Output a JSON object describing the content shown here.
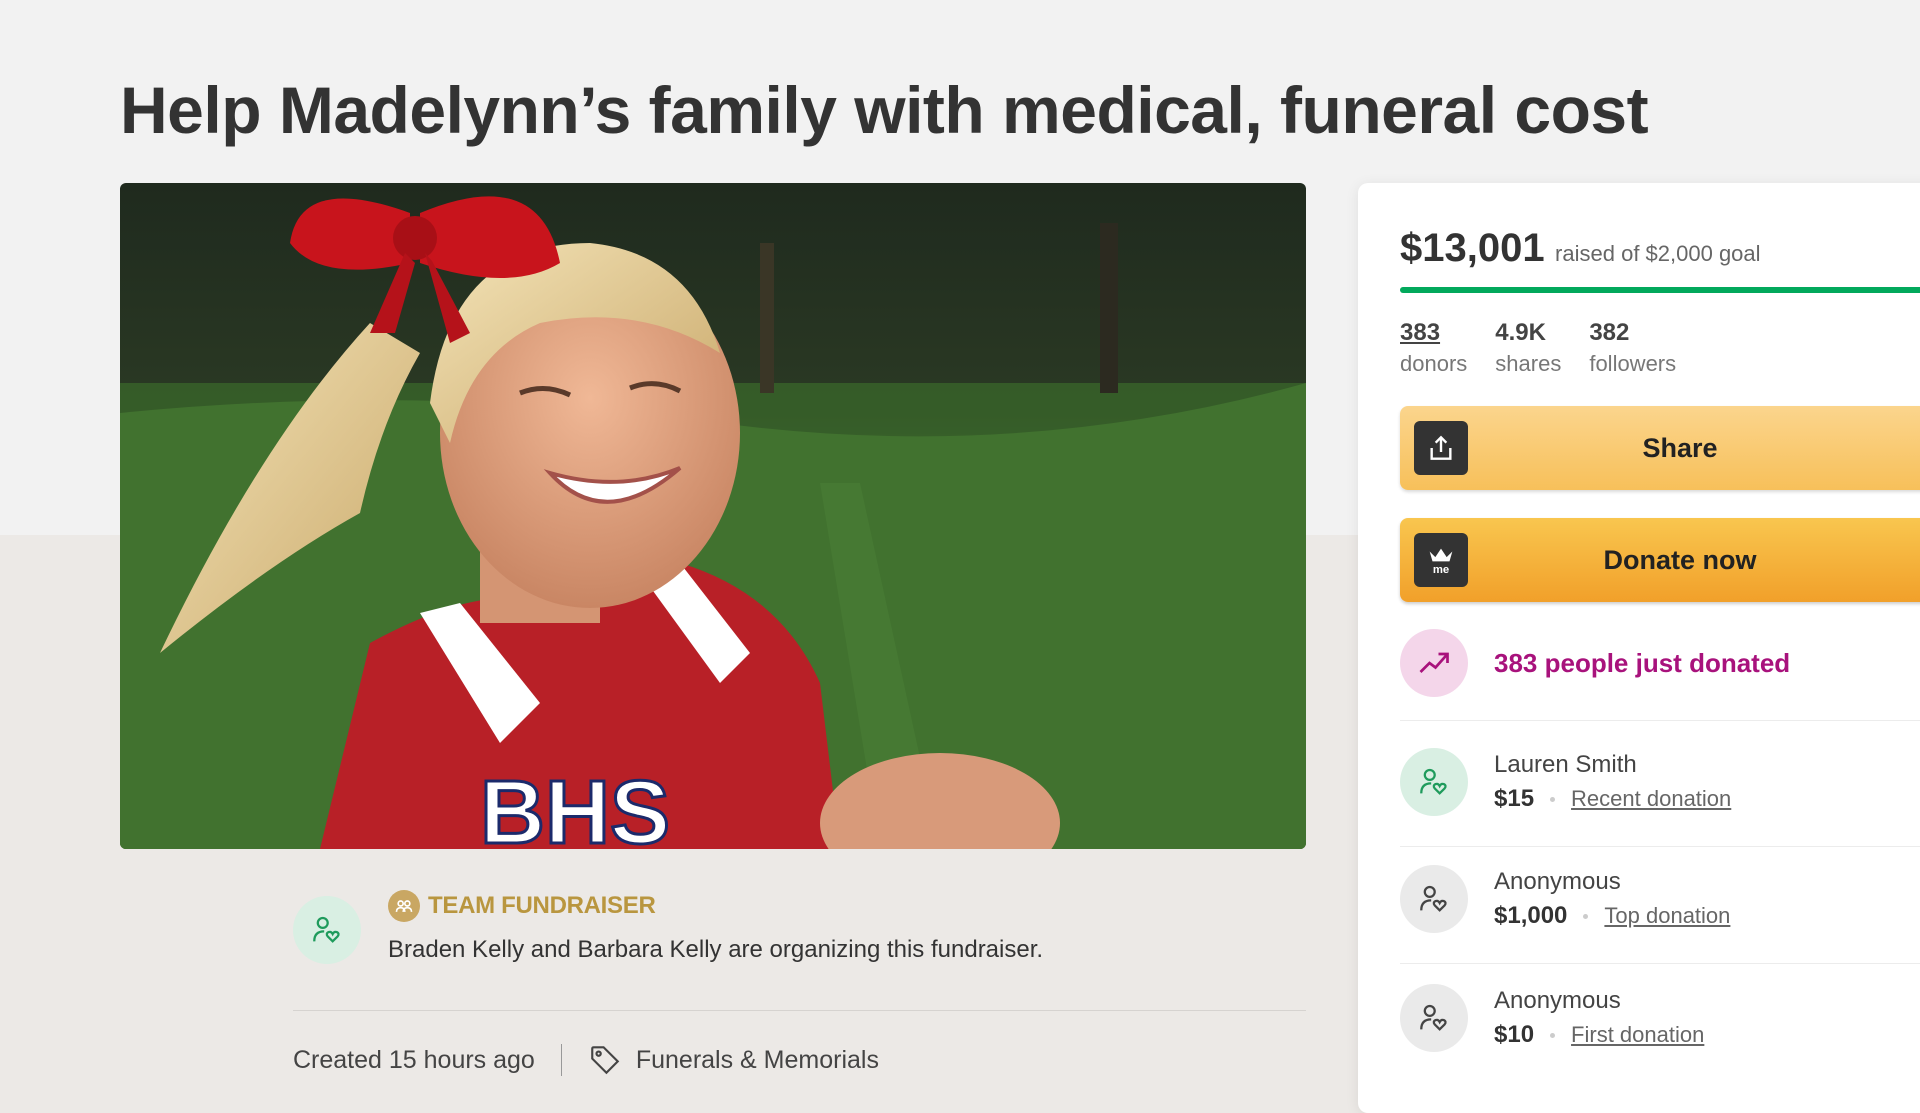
{
  "campaign": {
    "title": "Help Madelynn’s family with medical, funeral cost"
  },
  "organizer": {
    "team_label": "TEAM FUNDRAISER",
    "text": "Braden Kelly and Barbara Kelly are organizing this fundraiser.",
    "created": "Created 15 hours ago",
    "category": "Funerals & Memorials"
  },
  "donation": {
    "raised": "$13,001",
    "goal_text": "raised of $2,000 goal",
    "progress_fraction": 1.0,
    "stats": [
      {
        "value": "383",
        "label": "donors"
      },
      {
        "value": "4.9K",
        "label": "shares"
      },
      {
        "value": "382",
        "label": "followers"
      }
    ],
    "share_label": "Share",
    "donate_label": "Donate now",
    "trend_text": "383 people just donated",
    "donors": [
      {
        "name": "Lauren Smith",
        "amount": "$15",
        "tag": "Recent donation"
      },
      {
        "name": "Anonymous",
        "amount": "$1,000",
        "tag": "Top donation"
      },
      {
        "name": "Anonymous",
        "amount": "$10",
        "tag": "First donation"
      }
    ]
  },
  "colors": {
    "progress": "#02a95c",
    "trend": "#a8127c",
    "team": "#b9963f",
    "share_button": "#f7c05a",
    "donate_button": "#f1a02a"
  },
  "icons": {
    "share": "share-upload-icon",
    "donate": "gofundme-logo-icon",
    "trend": "trending-up-icon",
    "donor": "user-heart-icon",
    "tag": "tag-icon",
    "team": "team-icon"
  }
}
